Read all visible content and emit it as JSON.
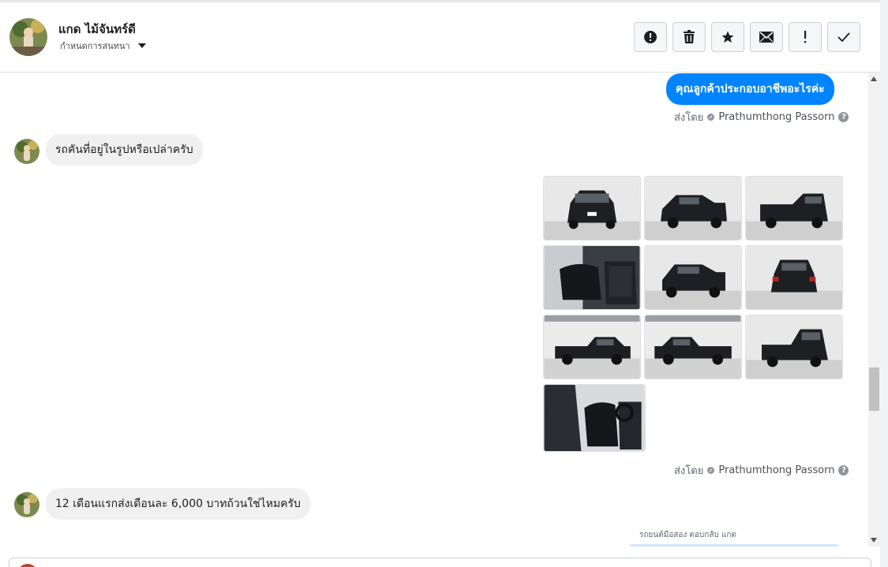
{
  "header": {
    "contact_name": "แกด ไม้จันทร์ดี",
    "assign_label": "กำหนดการสนทนา",
    "actions": [
      {
        "name": "mark-spam-button",
        "icon": "alert-circle-icon"
      },
      {
        "name": "delete-button",
        "icon": "trash-icon"
      },
      {
        "name": "star-button",
        "icon": "star-icon"
      },
      {
        "name": "mark-unread-button",
        "icon": "envelope-icon"
      },
      {
        "name": "follow-up-button",
        "icon": "exclamation-icon"
      },
      {
        "name": "mark-done-button",
        "icon": "check-icon"
      }
    ]
  },
  "messages": [
    {
      "direction": "outgoing",
      "text": "คุณลูกค้าประกอบอาชีพอะไรค่ะ",
      "sent_by_label": "ส่งโดย",
      "agent": "Prathumthong Passorn"
    },
    {
      "direction": "incoming",
      "text": "รถคันที่อยู่ในรูปหรือเปล่าครับ"
    },
    {
      "direction": "outgoing",
      "type": "photos",
      "photo_count": 10,
      "sent_by_label": "ส่งโดย",
      "agent": "Prathumthong Passorn"
    },
    {
      "direction": "incoming",
      "text": "12 เดือนแรกส่งเดือนละ 6,000 บาทถ้วนใช่ไหมครับ"
    }
  ],
  "reply_context": "รถยนต์มือสอง ตอบกลับ แกด",
  "help_glyph": "?",
  "colors": {
    "brand_blue": "#0084ff",
    "incoming_bg": "#f0f0f0"
  }
}
